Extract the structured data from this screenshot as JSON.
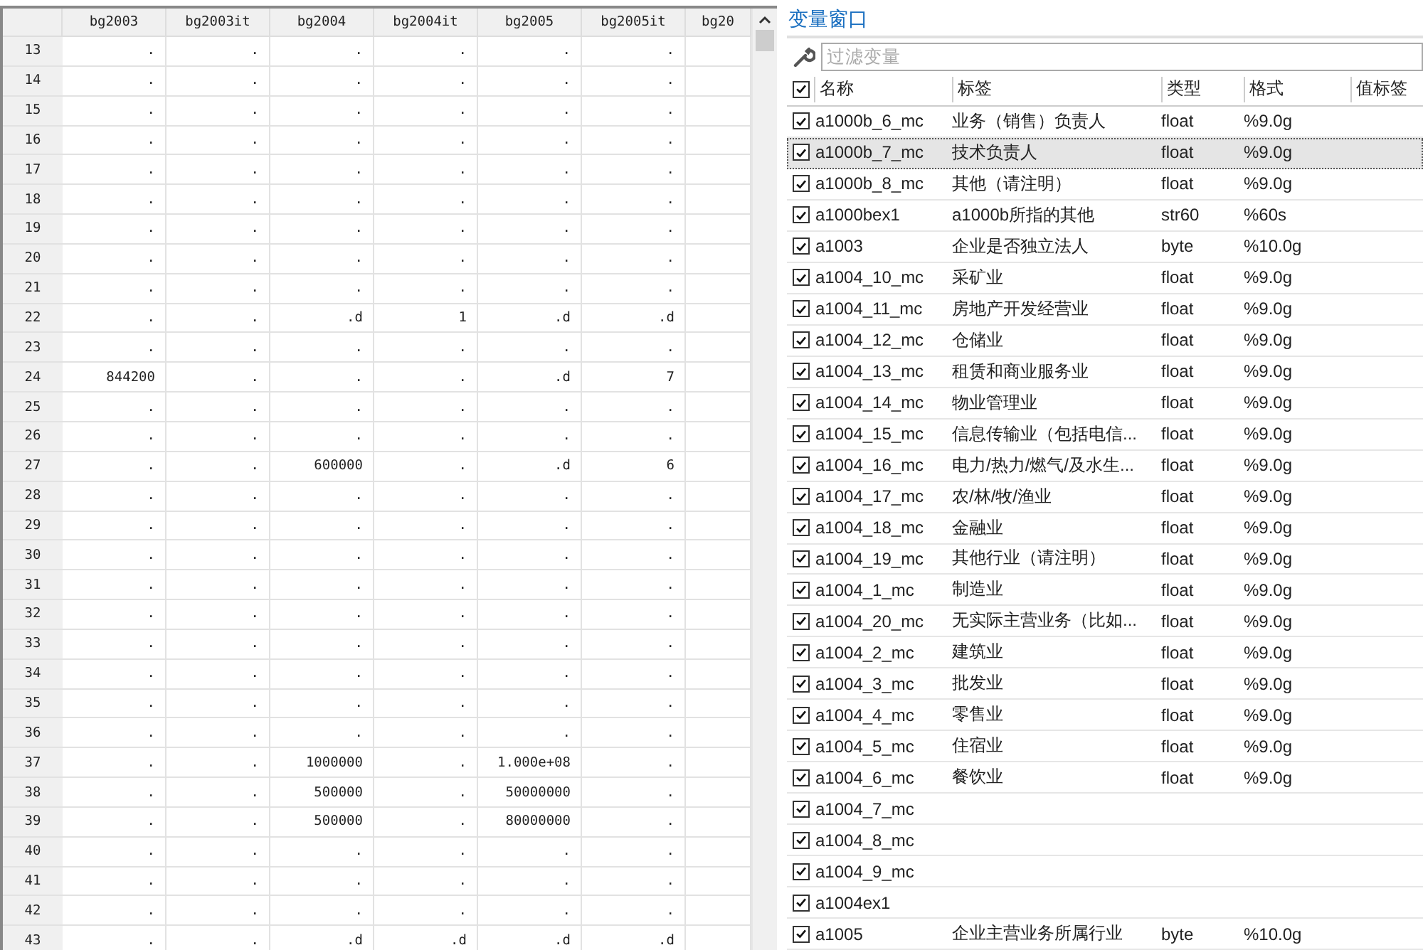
{
  "data_editor": {
    "columns": [
      "bg2003",
      "bg2003it",
      "bg2004",
      "bg2004it",
      "bg2005",
      "bg2005it",
      "bg20"
    ],
    "rows": [
      {
        "number": "13",
        "cells": [
          ".",
          ".",
          ".",
          ".",
          ".",
          "."
        ]
      },
      {
        "number": "14",
        "cells": [
          ".",
          ".",
          ".",
          ".",
          ".",
          "."
        ]
      },
      {
        "number": "15",
        "cells": [
          ".",
          ".",
          ".",
          ".",
          ".",
          "."
        ]
      },
      {
        "number": "16",
        "cells": [
          ".",
          ".",
          ".",
          ".",
          ".",
          "."
        ]
      },
      {
        "number": "17",
        "cells": [
          ".",
          ".",
          ".",
          ".",
          ".",
          "."
        ]
      },
      {
        "number": "18",
        "cells": [
          ".",
          ".",
          ".",
          ".",
          ".",
          "."
        ]
      },
      {
        "number": "19",
        "cells": [
          ".",
          ".",
          ".",
          ".",
          ".",
          "."
        ]
      },
      {
        "number": "20",
        "cells": [
          ".",
          ".",
          ".",
          ".",
          ".",
          "."
        ]
      },
      {
        "number": "21",
        "cells": [
          ".",
          ".",
          ".",
          ".",
          ".",
          "."
        ]
      },
      {
        "number": "22",
        "cells": [
          ".",
          ".",
          ".d",
          "1",
          ".d",
          ".d"
        ]
      },
      {
        "number": "23",
        "cells": [
          ".",
          ".",
          ".",
          ".",
          ".",
          "."
        ]
      },
      {
        "number": "24",
        "cells": [
          "844200",
          ".",
          ".",
          ".",
          ".d",
          "7"
        ]
      },
      {
        "number": "25",
        "cells": [
          ".",
          ".",
          ".",
          ".",
          ".",
          "."
        ]
      },
      {
        "number": "26",
        "cells": [
          ".",
          ".",
          ".",
          ".",
          ".",
          "."
        ]
      },
      {
        "number": "27",
        "cells": [
          ".",
          ".",
          "600000",
          ".",
          ".d",
          "6"
        ]
      },
      {
        "number": "28",
        "cells": [
          ".",
          ".",
          ".",
          ".",
          ".",
          "."
        ]
      },
      {
        "number": "29",
        "cells": [
          ".",
          ".",
          ".",
          ".",
          ".",
          "."
        ]
      },
      {
        "number": "30",
        "cells": [
          ".",
          ".",
          ".",
          ".",
          ".",
          "."
        ]
      },
      {
        "number": "31",
        "cells": [
          ".",
          ".",
          ".",
          ".",
          ".",
          "."
        ]
      },
      {
        "number": "32",
        "cells": [
          ".",
          ".",
          ".",
          ".",
          ".",
          "."
        ]
      },
      {
        "number": "33",
        "cells": [
          ".",
          ".",
          ".",
          ".",
          ".",
          "."
        ]
      },
      {
        "number": "34",
        "cells": [
          ".",
          ".",
          ".",
          ".",
          ".",
          "."
        ]
      },
      {
        "number": "35",
        "cells": [
          ".",
          ".",
          ".",
          ".",
          ".",
          "."
        ]
      },
      {
        "number": "36",
        "cells": [
          ".",
          ".",
          ".",
          ".",
          ".",
          "."
        ]
      },
      {
        "number": "37",
        "cells": [
          ".",
          ".",
          "1000000",
          ".",
          "1.000e+08",
          "."
        ]
      },
      {
        "number": "38",
        "cells": [
          ".",
          ".",
          "500000",
          ".",
          "50000000",
          "."
        ]
      },
      {
        "number": "39",
        "cells": [
          ".",
          ".",
          "500000",
          ".",
          "80000000",
          "."
        ]
      },
      {
        "number": "40",
        "cells": [
          ".",
          ".",
          ".",
          ".",
          ".",
          "."
        ]
      },
      {
        "number": "41",
        "cells": [
          ".",
          ".",
          ".",
          ".",
          ".",
          "."
        ]
      },
      {
        "number": "42",
        "cells": [
          ".",
          ".",
          ".",
          ".",
          ".",
          "."
        ]
      },
      {
        "number": "43",
        "cells": [
          ".",
          ".",
          ".d",
          ".d",
          ".d",
          ".d"
        ]
      }
    ]
  },
  "variables_window": {
    "title": "变量窗口",
    "filter": {
      "placeholder": "过滤变量"
    },
    "header": {
      "checked": true,
      "columns": [
        "名称",
        "标签",
        "类型",
        "格式",
        "值标签"
      ]
    },
    "rows": [
      {
        "checked": true,
        "selected": false,
        "name": "a1000b_6_mc",
        "label": "业务（销售）负责人",
        "type": "float",
        "format": "%9.0g"
      },
      {
        "checked": true,
        "selected": true,
        "name": "a1000b_7_mc",
        "label": "技术负责人",
        "type": "float",
        "format": "%9.0g"
      },
      {
        "checked": true,
        "selected": false,
        "name": "a1000b_8_mc",
        "label": "其他（请注明）",
        "type": "float",
        "format": "%9.0g"
      },
      {
        "checked": true,
        "selected": false,
        "name": "a1000bex1",
        "label": "a1000b所指的其他",
        "type": "str60",
        "format": "%60s"
      },
      {
        "checked": true,
        "selected": false,
        "name": "a1003",
        "label": "企业是否独立法人",
        "type": "byte",
        "format": "%10.0g"
      },
      {
        "checked": true,
        "selected": false,
        "name": "a1004_10_mc",
        "label": "采矿业",
        "type": "float",
        "format": "%9.0g"
      },
      {
        "checked": true,
        "selected": false,
        "name": "a1004_11_mc",
        "label": "房地产开发经营业",
        "type": "float",
        "format": "%9.0g"
      },
      {
        "checked": true,
        "selected": false,
        "name": "a1004_12_mc",
        "label": "仓储业",
        "type": "float",
        "format": "%9.0g"
      },
      {
        "checked": true,
        "selected": false,
        "name": "a1004_13_mc",
        "label": "租赁和商业服务业",
        "type": "float",
        "format": "%9.0g"
      },
      {
        "checked": true,
        "selected": false,
        "name": "a1004_14_mc",
        "label": "物业管理业",
        "type": "float",
        "format": "%9.0g"
      },
      {
        "checked": true,
        "selected": false,
        "name": "a1004_15_mc",
        "label": "信息传输业（包括电信...",
        "type": "float",
        "format": "%9.0g"
      },
      {
        "checked": true,
        "selected": false,
        "name": "a1004_16_mc",
        "label": "电力/热力/燃气/及水生...",
        "type": "float",
        "format": "%9.0g"
      },
      {
        "checked": true,
        "selected": false,
        "name": "a1004_17_mc",
        "label": "农/林/牧/渔业",
        "type": "float",
        "format": "%9.0g"
      },
      {
        "checked": true,
        "selected": false,
        "name": "a1004_18_mc",
        "label": "金融业",
        "type": "float",
        "format": "%9.0g"
      },
      {
        "checked": true,
        "selected": false,
        "name": "a1004_19_mc",
        "label": "其他行业（请注明）",
        "type": "float",
        "format": "%9.0g"
      },
      {
        "checked": true,
        "selected": false,
        "name": "a1004_1_mc",
        "label": "制造业",
        "type": "float",
        "format": "%9.0g"
      },
      {
        "checked": true,
        "selected": false,
        "name": "a1004_20_mc",
        "label": "无实际主营业务（比如...",
        "type": "float",
        "format": "%9.0g"
      },
      {
        "checked": true,
        "selected": false,
        "name": "a1004_2_mc",
        "label": "建筑业",
        "type": "float",
        "format": "%9.0g"
      },
      {
        "checked": true,
        "selected": false,
        "name": "a1004_3_mc",
        "label": "批发业",
        "type": "float",
        "format": "%9.0g"
      },
      {
        "checked": true,
        "selected": false,
        "name": "a1004_4_mc",
        "label": "零售业",
        "type": "float",
        "format": "%9.0g"
      },
      {
        "checked": true,
        "selected": false,
        "name": "a1004_5_mc",
        "label": "住宿业",
        "type": "float",
        "format": "%9.0g"
      },
      {
        "checked": true,
        "selected": false,
        "name": "a1004_6_mc",
        "label": "餐饮业",
        "type": "float",
        "format": "%9.0g"
      },
      {
        "checked": true,
        "selected": false,
        "name": "a1004_7_mc"
      },
      {
        "checked": true,
        "selected": false,
        "name": "a1004_8_mc"
      },
      {
        "checked": true,
        "selected": false,
        "name": "a1004_9_mc"
      },
      {
        "checked": true,
        "selected": false,
        "name": "a1004ex1"
      },
      {
        "checked": true,
        "selected": false,
        "name": "a1005",
        "label": "企业主营业务所属行业",
        "type": "byte",
        "format": "%10.0g"
      }
    ]
  }
}
